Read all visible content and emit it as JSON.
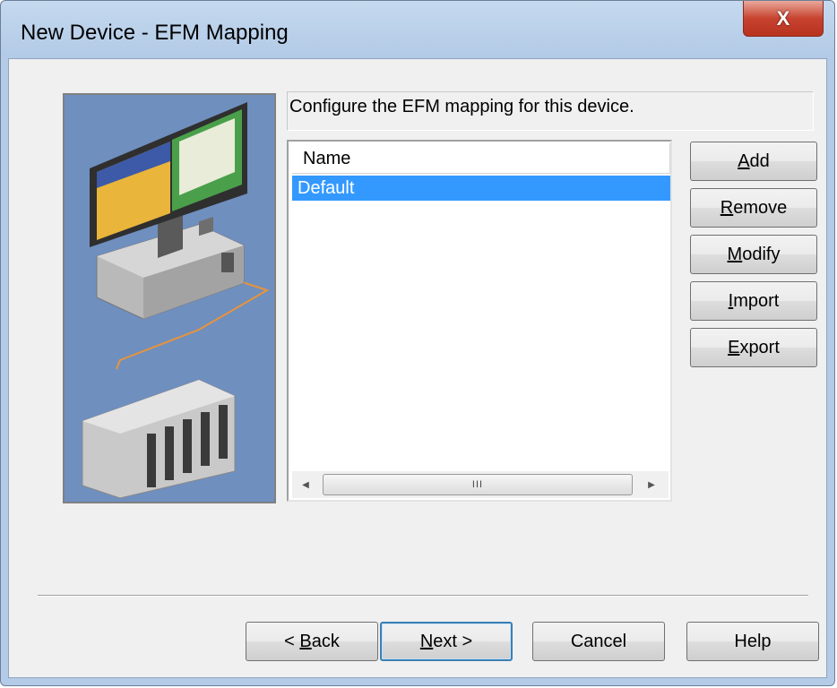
{
  "window": {
    "title": "New Device - EFM Mapping",
    "close_glyph": "X"
  },
  "instruction": "Configure the EFM mapping for this device.",
  "list": {
    "column_header": "Name",
    "rows": [
      "Default"
    ],
    "scroll_thumb_grip": "III"
  },
  "side_buttons": [
    {
      "label": "Add",
      "mnemonic": "A"
    },
    {
      "label": "Remove",
      "mnemonic": "R"
    },
    {
      "label": "Modify",
      "mnemonic": "M"
    },
    {
      "label": "Import",
      "mnemonic": "I"
    },
    {
      "label": "Export",
      "mnemonic": "E"
    }
  ],
  "bottom_buttons": [
    {
      "label": "< Back",
      "mnemonic": "B"
    },
    {
      "label": "Next >",
      "mnemonic": "N"
    },
    {
      "label": "Cancel"
    },
    {
      "label": "Help"
    }
  ],
  "icons": {
    "close": "close-icon",
    "scroll_left": "scroll-left-arrow-icon",
    "scroll_right": "scroll-right-arrow-icon"
  },
  "colors": {
    "selection": "#3399ff",
    "illustration_bg": "#6f8fbf",
    "close_button": "#c7432f",
    "default_button_border": "#3c7fb1"
  }
}
